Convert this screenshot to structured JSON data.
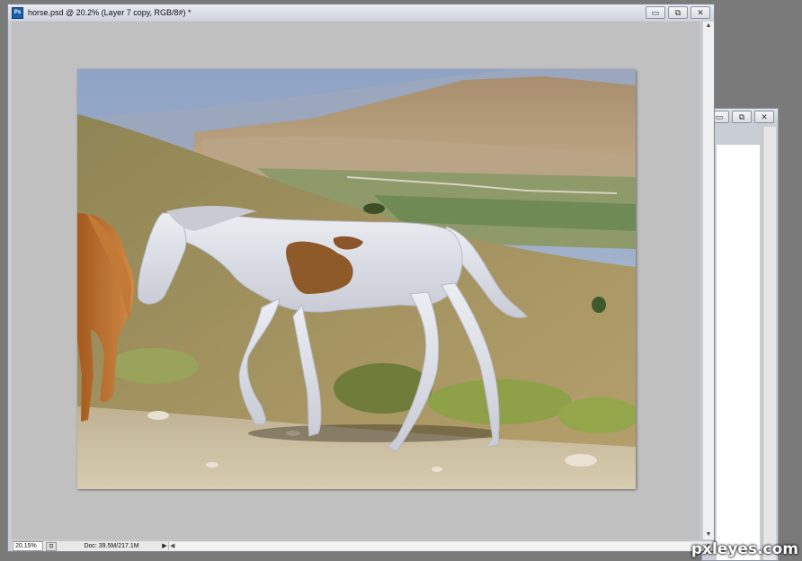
{
  "document_window": {
    "title": "horse.psd @ 20.2% (Layer 7 copy, RGB/8#) *",
    "app_badge": "Ps",
    "controls": {
      "minimize": "▭",
      "restore": "⧉",
      "close": "✕"
    }
  },
  "background_window": {
    "controls": {
      "minimize": "▭",
      "restore": "⧉",
      "close": "✕"
    }
  },
  "statusbar": {
    "zoom": "20.15%",
    "doc_info": "Doc: 39.5M/217.1M",
    "arrow": "▶"
  },
  "scroll": {
    "up": "▲",
    "down": "▼",
    "left": "◀",
    "right": "▶"
  },
  "watermark": "pxleyes.com",
  "colors": {
    "window_frame": "#c8cdd6",
    "canvas_bg": "#c0c0c0",
    "sky": "#9fb1cc",
    "horse_white": "#dfe1e8",
    "patch_brown": "#8e5a2a",
    "chestnut_horse": "#b8692a"
  }
}
